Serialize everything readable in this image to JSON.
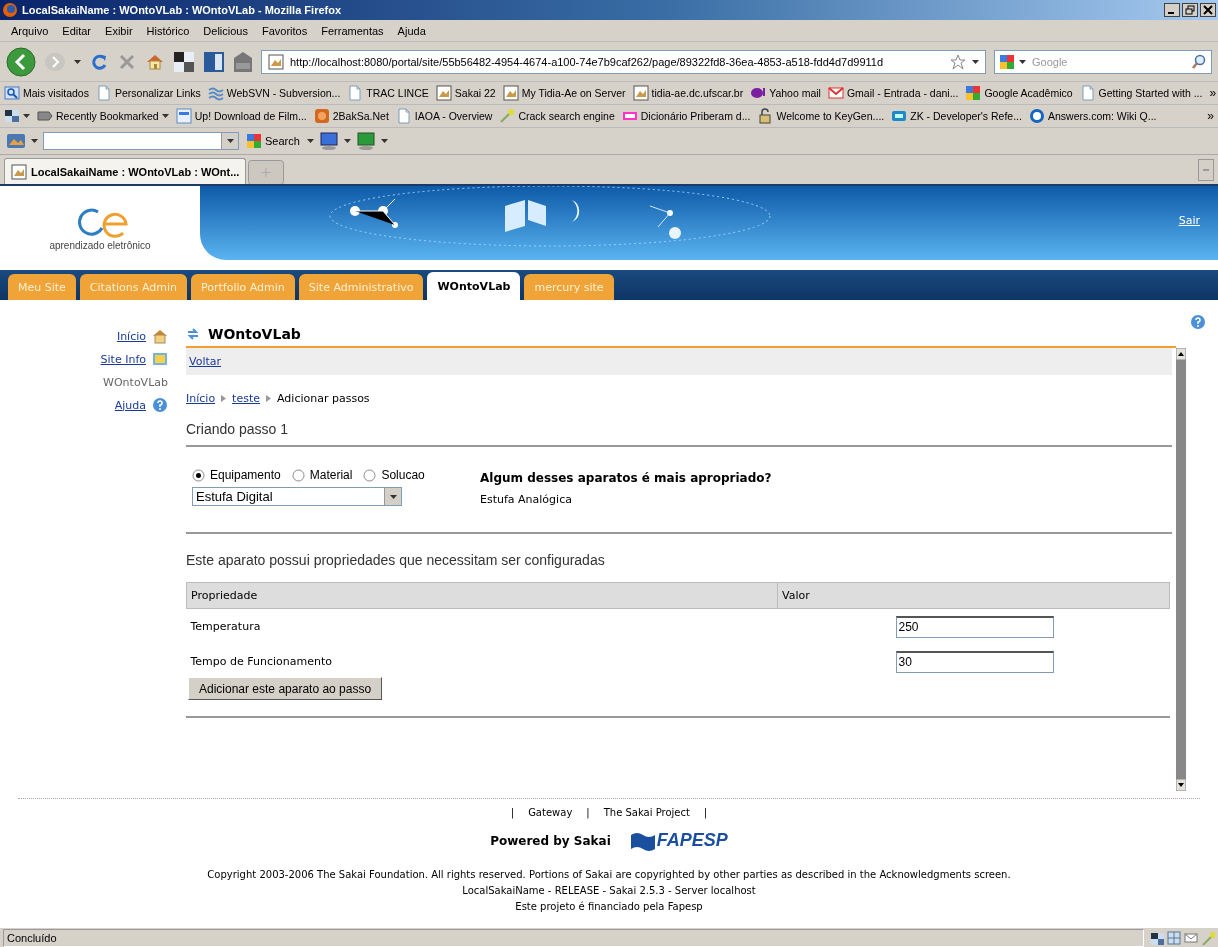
{
  "window": {
    "title": "LocalSakaiName : WOntoVLab : WOntoVLab - Mozilla Firefox"
  },
  "menu_bar": [
    "Arquivo",
    "Editar",
    "Exibir",
    "Histórico",
    "Delicious",
    "Favoritos",
    "Ferramentas",
    "Ajuda"
  ],
  "address_bar": {
    "url": "http://localhost:8080/portal/site/55b56482-4954-4674-a100-74e7b9caf262/page/89322fd8-36ea-4853-a518-fdd4d7d9911d"
  },
  "search_box": {
    "placeholder": "Google"
  },
  "bookmarks": {
    "items": [
      {
        "label": "Mais visitados",
        "kind": "search"
      },
      {
        "label": "Personalizar Links",
        "kind": "page"
      },
      {
        "label": "WebSVN - Subversion...",
        "kind": "svn"
      },
      {
        "label": "TRAC LINCE",
        "kind": "page"
      },
      {
        "label": "Sakai 22",
        "kind": "site"
      },
      {
        "label": "My Tidia-Ae on Server",
        "kind": "site"
      },
      {
        "label": "tidia-ae.dc.ufscar.br",
        "kind": "site"
      },
      {
        "label": "Yahoo mail",
        "kind": "purple"
      },
      {
        "label": "Gmail - Entrada - dani...",
        "kind": "mail"
      },
      {
        "label": "Google Acadêmico",
        "kind": "google"
      },
      {
        "label": "Getting Started with ...",
        "kind": "page"
      }
    ],
    "overflow": "»"
  },
  "bookmarks_2": {
    "items": [
      {
        "kind": "grid",
        "menu": true
      },
      {
        "label": "Recently Bookmarked",
        "kind": "label",
        "menu": true
      },
      {
        "label": "Up! Download de Film...",
        "kind": "up",
        "menu": false
      },
      {
        "label": "2BakSa.Net",
        "kind": "bak",
        "menu": false
      },
      {
        "label": "IAOA - Overview",
        "kind": "page",
        "menu": false
      },
      {
        "label": "Crack search engine",
        "kind": "wand",
        "menu": false
      },
      {
        "label": "Dicionário Priberam d...",
        "kind": "pink",
        "menu": false
      },
      {
        "label": "Welcome to KeyGen....",
        "kind": "lock",
        "menu": false
      },
      {
        "label": "ZK - Developer's Refe...",
        "kind": "zk",
        "menu": false
      },
      {
        "label": "Answers.com: Wiki Q...",
        "kind": "answers",
        "menu": false
      }
    ],
    "overflow": "»"
  },
  "search_toolbar": {
    "button": "Search"
  },
  "browser_tabs": [
    {
      "label": "LocalSakaiName : WOntoVLab : WOnt...",
      "selected": true
    }
  ],
  "site": {
    "logo_text": "aprendizado eletrônico",
    "logout": "Sair",
    "tabs": [
      {
        "label": "Meu Site",
        "selected": false
      },
      {
        "label": "Citations Admin",
        "selected": false
      },
      {
        "label": "Portfolio Admin",
        "selected": false
      },
      {
        "label": "Site Administrativo",
        "selected": false
      },
      {
        "label": "WOntoVLab",
        "selected": true
      },
      {
        "label": "mercury site",
        "selected": false
      }
    ],
    "sidebar": [
      {
        "label": "Início",
        "kind": "home",
        "selected": false
      },
      {
        "label": "Site Info",
        "kind": "info",
        "selected": false
      },
      {
        "label": "WOntoVLab",
        "kind": "tool",
        "selected": true
      },
      {
        "label": "Ajuda",
        "kind": "help",
        "selected": false
      }
    ]
  },
  "tool": {
    "title": "WOntoVLab",
    "back": "Voltar",
    "breadcrumb": [
      {
        "label": "Início",
        "link": true
      },
      {
        "label": "teste",
        "link": true
      },
      {
        "label": "Adicionar passos",
        "link": false
      }
    ],
    "step_title": "Criando passo 1",
    "options": [
      {
        "label": "Equipamento",
        "selected": true
      },
      {
        "label": "Material",
        "selected": false
      },
      {
        "label": "Solucao",
        "selected": false
      }
    ],
    "select_value": "Estufa Digital",
    "suggestion_title": "Algum desses aparatos é mais apropriado?",
    "suggestions": [
      "Estufa Analógica"
    ],
    "properties_title": "Este aparato possui propriedades que necessitam ser configuradas",
    "columns": [
      "Propriedade",
      "Valor"
    ],
    "rows": [
      {
        "name": "Temperatura",
        "value": "250"
      },
      {
        "name": "Tempo de Funcionamento",
        "value": "30"
      }
    ],
    "add_button": "Adicionar este aparato ao passo"
  },
  "footer": {
    "links": [
      "Gateway",
      "The Sakai Project"
    ],
    "separator": "|",
    "powered": "Powered by Sakai",
    "sponsor": "FAPESP",
    "lines": [
      "Copyright 2003-2006 The Sakai Foundation. All rights reserved. Portions of Sakai are copyrighted by other parties as described in the Acknowledgments screen.",
      "LocalSakaiName - RELEASE - Sakai 2.5.3 - Server localhost",
      "Este projeto é financiado pela Fapesp"
    ]
  },
  "status_bar": {
    "text": "Concluído"
  }
}
